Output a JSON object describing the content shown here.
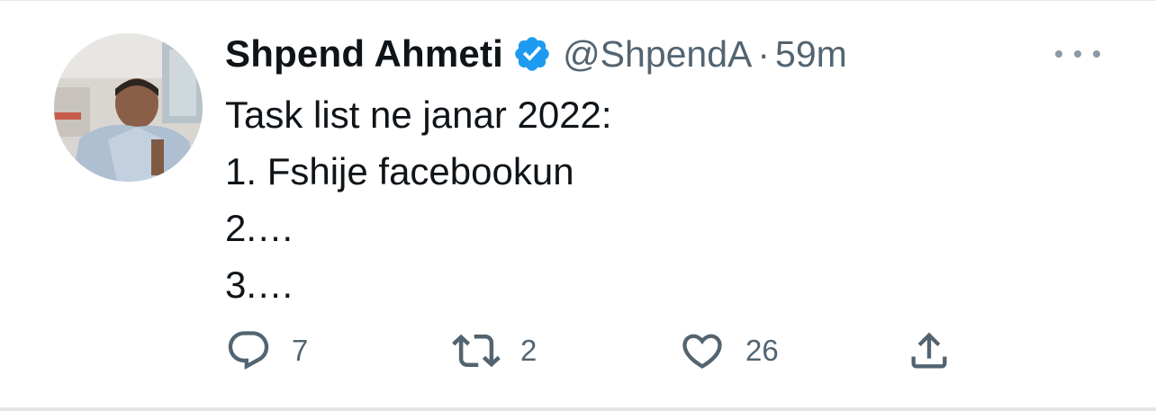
{
  "tweet": {
    "author_name": "Shpend Ahmeti",
    "handle": "@ShpendA",
    "separator": "·",
    "time": "59m",
    "verified": true,
    "verified_icon": "verified-badge-icon",
    "more_icon": "more-horizontal-icon",
    "text_lines": [
      "Task list ne janar 2022:",
      "1. Fshije facebookun",
      "2.…",
      "3.…"
    ]
  },
  "actions": {
    "reply": {
      "icon": "reply-icon",
      "count": "7"
    },
    "retweet": {
      "icon": "retweet-icon",
      "count": "2"
    },
    "like": {
      "icon": "heart-icon",
      "count": "26"
    },
    "share": {
      "icon": "share-icon"
    }
  },
  "colors": {
    "text_primary": "#0f1419",
    "text_secondary": "#536471",
    "verified_blue": "#1d9bf0"
  }
}
